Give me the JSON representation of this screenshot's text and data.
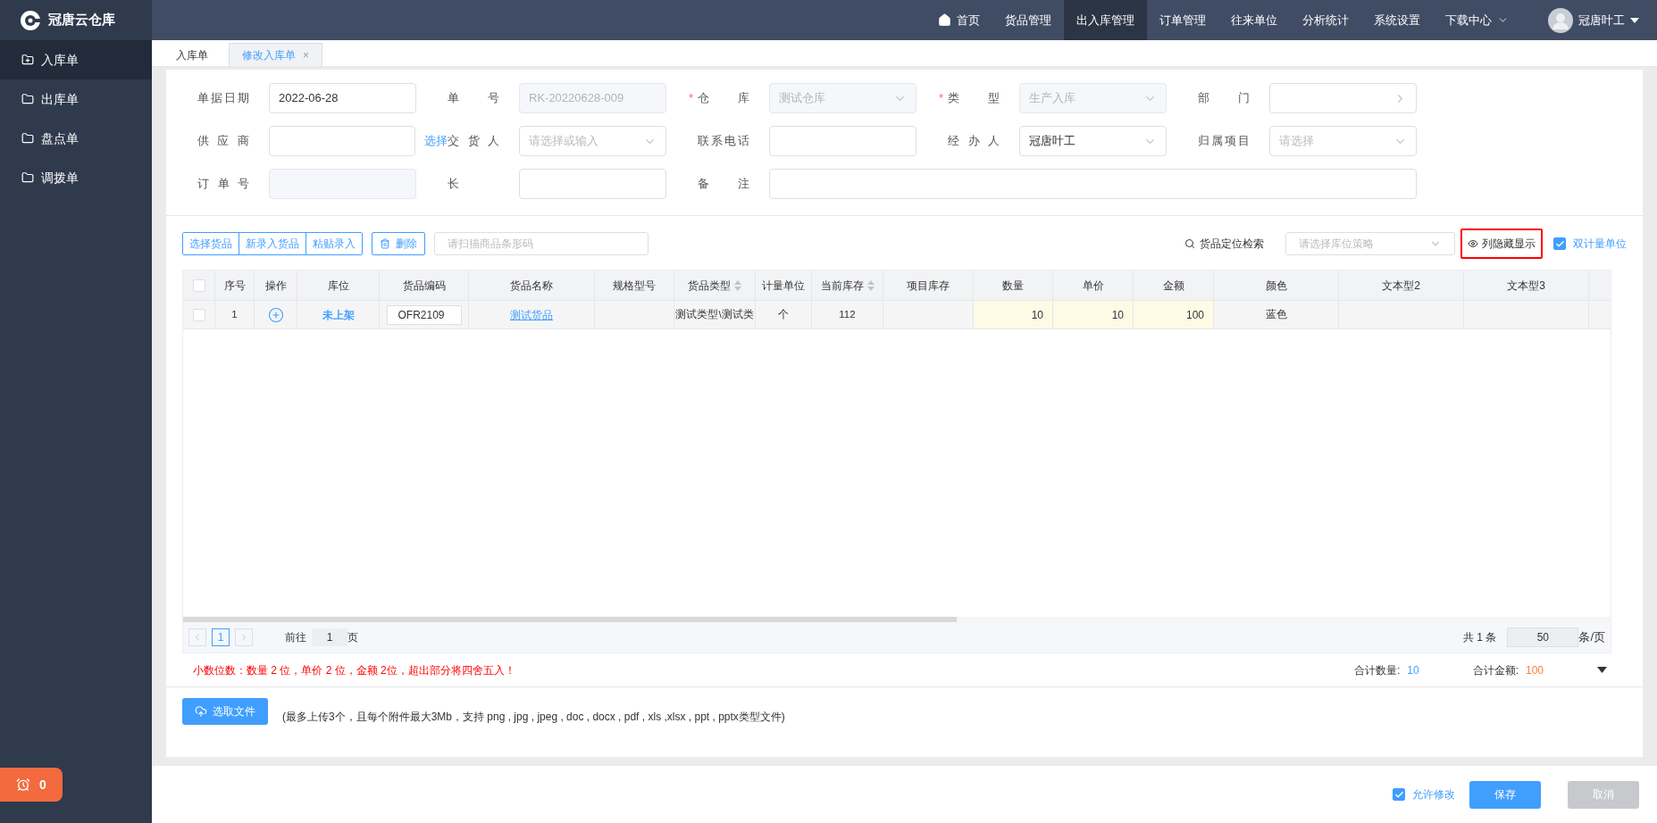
{
  "brand": "冠唐云仓库",
  "top_menu": [
    {
      "label": "首页",
      "kind": "home",
      "selected": false
    },
    {
      "label": "货品管理",
      "kind": "plain",
      "selected": false
    },
    {
      "label": "出入库管理",
      "kind": "plain",
      "selected": true
    },
    {
      "label": "订单管理",
      "kind": "plain",
      "selected": false
    },
    {
      "label": "往来单位",
      "kind": "plain",
      "selected": false
    },
    {
      "label": "分析统计",
      "kind": "plain",
      "selected": false
    },
    {
      "label": "系统设置",
      "kind": "plain",
      "selected": false
    },
    {
      "label": "下载中心",
      "kind": "dropdown",
      "selected": false
    }
  ],
  "user": {
    "name": "冠唐叶工"
  },
  "sidebar": {
    "items": [
      {
        "label": "入库单",
        "selected": true
      },
      {
        "label": "出库单",
        "selected": false
      },
      {
        "label": "盘点单",
        "selected": false
      },
      {
        "label": "调拨单",
        "selected": false
      }
    ],
    "alarm_count": "0"
  },
  "tabs": [
    {
      "label": "入库单",
      "selected": false
    },
    {
      "label": "修改入库单",
      "selected": true,
      "close": "×"
    }
  ],
  "form": {
    "rows": [
      [
        {
          "label": "单据日期",
          "kind": "input",
          "value": "2022-06-28"
        },
        {
          "label": "单号",
          "kind": "input",
          "value": "RK-20220628-009",
          "disabled": true
        },
        {
          "label": "仓库",
          "kind": "select",
          "value": "测试仓库",
          "disabled": true,
          "required_mark": "*"
        },
        {
          "label": "类型",
          "kind": "select",
          "value": "生产入库",
          "disabled": true,
          "required_mark": "*"
        },
        {
          "label": "部门",
          "kind": "cascader"
        }
      ],
      [
        {
          "label": "供应商",
          "kind": "input",
          "link": "选择"
        },
        {
          "label": "交货人",
          "kind": "select",
          "placeholder": "请选择或输入"
        },
        {
          "label": "联系电话",
          "kind": "input"
        },
        {
          "label": "经办人",
          "kind": "select",
          "value": "冠唐叶工"
        },
        {
          "label": "归属项目",
          "kind": "select",
          "placeholder": "请选择"
        }
      ],
      [
        {
          "label": "订单号",
          "kind": "input",
          "disabled": true
        },
        {
          "label": "长",
          "kind": "input"
        },
        {
          "label": "备注",
          "kind": "wide"
        }
      ]
    ]
  },
  "toolbar": {
    "group_buttons": [
      "选择货品",
      "新录入货品",
      "粘贴录入"
    ],
    "delete_button": "删除",
    "scan_placeholder": "请扫描商品条形码",
    "locate_label": "货品定位检索",
    "strategy_placeholder": "请选择库位策略",
    "columns_button": {
      "label": "列隐藏显示",
      "highlighted": true
    },
    "dual_unit": {
      "label": "双计量单位",
      "checked": true
    }
  },
  "table": {
    "columns": [
      {
        "kind": "check"
      },
      {
        "label": "序号",
        "kind": "text",
        "sortable": false
      },
      {
        "label": "操作",
        "kind": "action",
        "sortable": false
      },
      {
        "label": "库位",
        "kind": "location",
        "sortable": false
      },
      {
        "label": "货品编码",
        "kind": "code",
        "sortable": false
      },
      {
        "label": "货品名称",
        "kind": "link",
        "sortable": false
      },
      {
        "label": "规格型号",
        "kind": "text",
        "sortable": false
      },
      {
        "label": "货品类型",
        "kind": "text",
        "sortable": true
      },
      {
        "label": "计量单位",
        "kind": "text",
        "sortable": false
      },
      {
        "label": "当前库存",
        "kind": "text",
        "sortable": true
      },
      {
        "label": "项目库存",
        "kind": "text",
        "sortable": false
      },
      {
        "label": "数量",
        "kind": "edit",
        "sortable": false
      },
      {
        "label": "单价",
        "kind": "edit",
        "sortable": false
      },
      {
        "label": "金额",
        "kind": "edit",
        "sortable": false
      },
      {
        "label": "颜色",
        "kind": "text",
        "sortable": false
      },
      {
        "label": "文本型2",
        "kind": "text",
        "sortable": false
      },
      {
        "label": "文本型3",
        "kind": "text",
        "sortable": false
      }
    ],
    "header_checked": false,
    "rows": [
      {
        "checked": false,
        "cells": [
          null,
          "1",
          null,
          "未上架",
          "OFR2109",
          "测试货品",
          null,
          "测试类型\\测试类",
          "个",
          "112",
          null,
          "10",
          "10",
          "100",
          "蓝色",
          null,
          null
        ]
      }
    ]
  },
  "pagination": {
    "pages": [
      {
        "label": "1",
        "selected": true
      }
    ],
    "goto_label": "前往",
    "goto_value": "1",
    "page_suffix": "页",
    "total": "共 1 条",
    "page_size": "50",
    "size_suffix": "条/页"
  },
  "notice": "小数位数：数量 2 位，单价 2 位，金额 2位，超出部分将四舍五入！",
  "totals": [
    {
      "label": "合计数量:",
      "value": "10",
      "color": "#409eff"
    },
    {
      "label": "合计金额:",
      "value": "100",
      "color": "#f5813f"
    }
  ],
  "upload": {
    "button": "选取文件",
    "hint": "(最多上传3个，且每个附件最大3Mb，支持 png , jpg , jpeg , doc , docx , pdf , xls ,xlsx , ppt , pptx类型文件)"
  },
  "footer": {
    "allow_edit": {
      "label": "允许修改",
      "checked": true
    },
    "save": "保存",
    "cancel": {
      "label": "取消",
      "disabled": true
    }
  }
}
